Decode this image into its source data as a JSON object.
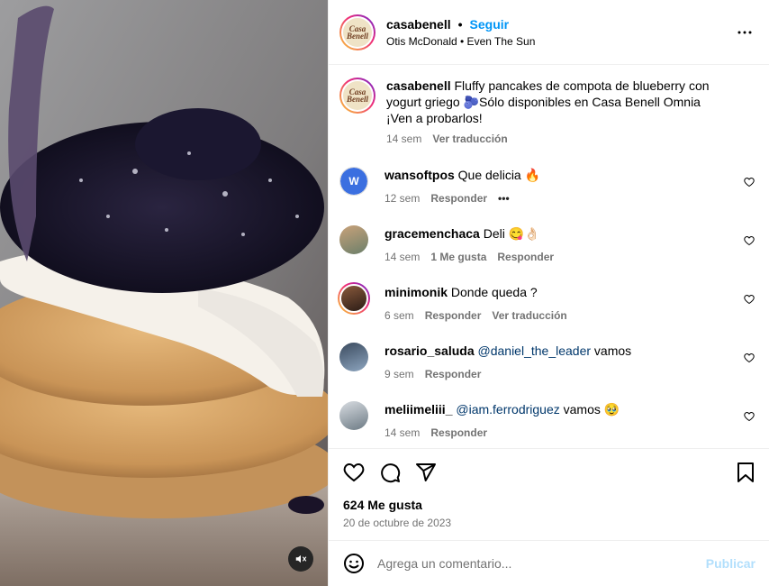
{
  "header": {
    "username": "casabenell",
    "separator": "•",
    "follow_label": "Seguir",
    "audio": "Otis McDonald • Even The Sun",
    "logo_text": "Casa Benell"
  },
  "caption": {
    "username": "casabenell",
    "text": "Fluffy pancakes de compota de blueberry con yogurt griego 🫐Sólo disponibles en Casa Benell Omnia ¡Ven a probarlos!",
    "time": "14 sem",
    "translate": "Ver traducción"
  },
  "comments": [
    {
      "username": "wansoftpos",
      "text": "Que delicia 🔥",
      "time": "12 sem",
      "likes": "",
      "reply": "Responder",
      "extra": "•••",
      "translate": ""
    },
    {
      "username": "gracemenchaca",
      "text": "Deli 😋👌🏻",
      "time": "14 sem",
      "likes": "1 Me gusta",
      "reply": "Responder",
      "extra": "",
      "translate": ""
    },
    {
      "username": "minimonik",
      "text": "Donde queda ?",
      "time": "6 sem",
      "likes": "",
      "reply": "Responder",
      "extra": "",
      "translate": "Ver traducción"
    },
    {
      "username": "rosario_saluda",
      "mention": "@daniel_the_leader",
      "text": " vamos",
      "time": "9 sem",
      "likes": "",
      "reply": "Responder",
      "extra": "",
      "translate": ""
    },
    {
      "username": "meliimeliii_",
      "mention": "@iam.ferrodriguez",
      "text": " vamos 🥹",
      "time": "14 sem",
      "likes": "",
      "reply": "Responder",
      "extra": "",
      "translate": ""
    }
  ],
  "post": {
    "likes": "624 Me gusta",
    "date": "20 de octubre de 2023"
  },
  "add_comment": {
    "placeholder": "Agrega un comentario...",
    "publish_label": "Publicar"
  },
  "colors": {
    "accent": "#0095f6",
    "publish_disabled": "#b2dffc",
    "muted_text": "#737373"
  }
}
